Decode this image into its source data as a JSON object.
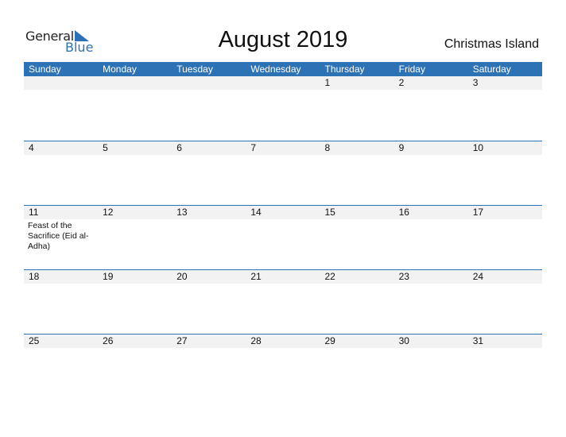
{
  "logo": {
    "general": "General",
    "blue": "Blue"
  },
  "title": "August 2019",
  "region": "Christmas Island",
  "days": [
    "Sunday",
    "Monday",
    "Tuesday",
    "Wednesday",
    "Thursday",
    "Friday",
    "Saturday"
  ],
  "weeks": [
    [
      {
        "d": ""
      },
      {
        "d": ""
      },
      {
        "d": ""
      },
      {
        "d": ""
      },
      {
        "d": "1"
      },
      {
        "d": "2"
      },
      {
        "d": "3"
      }
    ],
    [
      {
        "d": "4"
      },
      {
        "d": "5"
      },
      {
        "d": "6"
      },
      {
        "d": "7"
      },
      {
        "d": "8"
      },
      {
        "d": "9"
      },
      {
        "d": "10"
      }
    ],
    [
      {
        "d": "11",
        "e": "Feast of the Sacrifice (Eid al-Adha)"
      },
      {
        "d": "12"
      },
      {
        "d": "13"
      },
      {
        "d": "14"
      },
      {
        "d": "15"
      },
      {
        "d": "16"
      },
      {
        "d": "17"
      }
    ],
    [
      {
        "d": "18"
      },
      {
        "d": "19"
      },
      {
        "d": "20"
      },
      {
        "d": "21"
      },
      {
        "d": "22"
      },
      {
        "d": "23"
      },
      {
        "d": "24"
      }
    ],
    [
      {
        "d": "25"
      },
      {
        "d": "26"
      },
      {
        "d": "27"
      },
      {
        "d": "28"
      },
      {
        "d": "29"
      },
      {
        "d": "30"
      },
      {
        "d": "31"
      }
    ]
  ]
}
